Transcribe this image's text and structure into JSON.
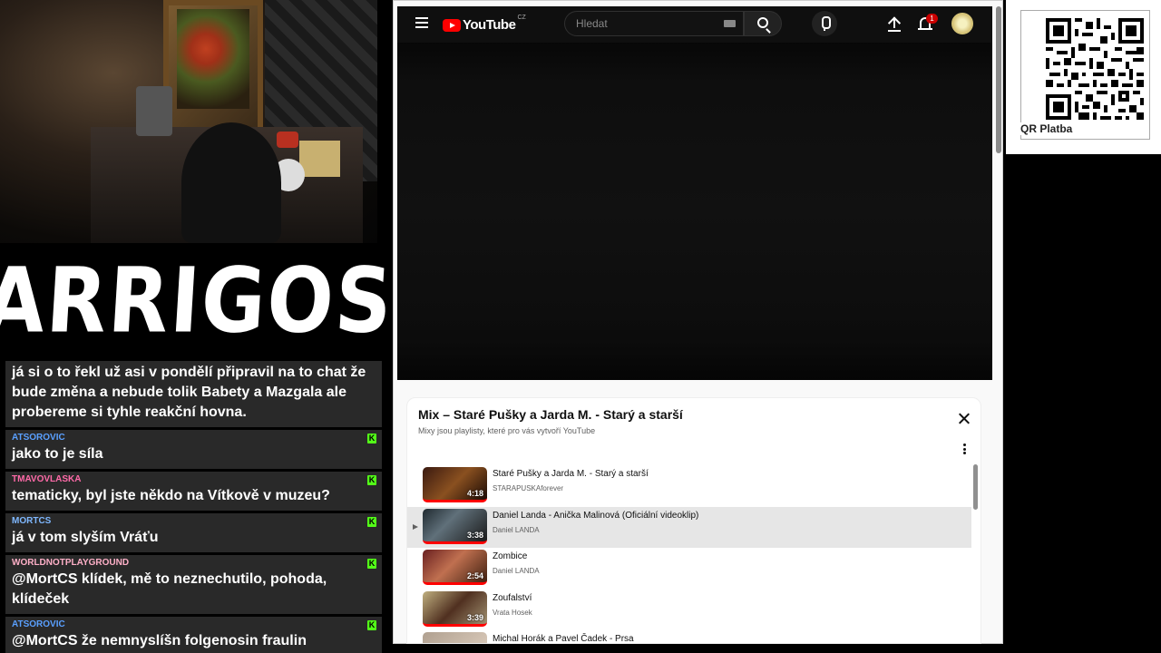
{
  "stream": {
    "logo_text": "ARRIGOS"
  },
  "chat": {
    "messages": [
      {
        "author": "",
        "author_color": "#ffffff",
        "text": "já si o to řekl už asi v pondělí připravil na to chat že bude změna a nebude tolik Babety a Mazgala ale probereme si tyhle reakční hovna."
      },
      {
        "author": "ATSOROVIC",
        "author_color": "#5aa0ff",
        "text": "jako to je síla"
      },
      {
        "author": "TMAVOVLASKA",
        "author_color": "#ff6aa8",
        "text": "tematicky, byl jste někdo na Vítkově v muzeu?"
      },
      {
        "author": "MORTCS",
        "author_color": "#7fb8ff",
        "text": "já v tom slyším Vráťu"
      },
      {
        "author": "WORLDNOTPLAYGROUND",
        "author_color": "#ffb0c8",
        "text": "@MortCS klídek, mě to neznechutilo, pohoda, klídeček"
      },
      {
        "author": "ATSOROVIC",
        "author_color": "#5aa0ff",
        "text": "@MortCS že nemnyslíšn folgenosin fraulin"
      }
    ],
    "platform_badge_icon": "kick-icon"
  },
  "youtube": {
    "logo_text": "YouTube",
    "country_code": "CZ",
    "search_placeholder": "Hledat",
    "notification_count": "1",
    "playlist": {
      "title": "Mix – Staré Pušky a Jarda M. - Starý a starší",
      "subtitle": "Mixy jsou playlisty, které pro vás vytvoří YouTube",
      "items": [
        {
          "title": "Staré Pušky a Jarda M. - Starý a starší",
          "channel": "STARAPUSKAforever",
          "duration": "4:18",
          "active": false
        },
        {
          "title": "Daniel Landa - Anička Malinová (Oficiální videoklip)",
          "channel": "Daniel LANDA",
          "duration": "3:38",
          "active": true
        },
        {
          "title": "Zombice",
          "channel": "Daniel LANDA",
          "duration": "2:54",
          "active": false
        },
        {
          "title": "Zoufalství",
          "channel": "Vrata Hosek",
          "duration": "3:39",
          "active": false
        },
        {
          "title": "Michal Horák a Pavel Čadek - Prsa",
          "channel": "",
          "duration": "",
          "active": false
        }
      ]
    }
  },
  "qr": {
    "label": "QR Platba"
  }
}
